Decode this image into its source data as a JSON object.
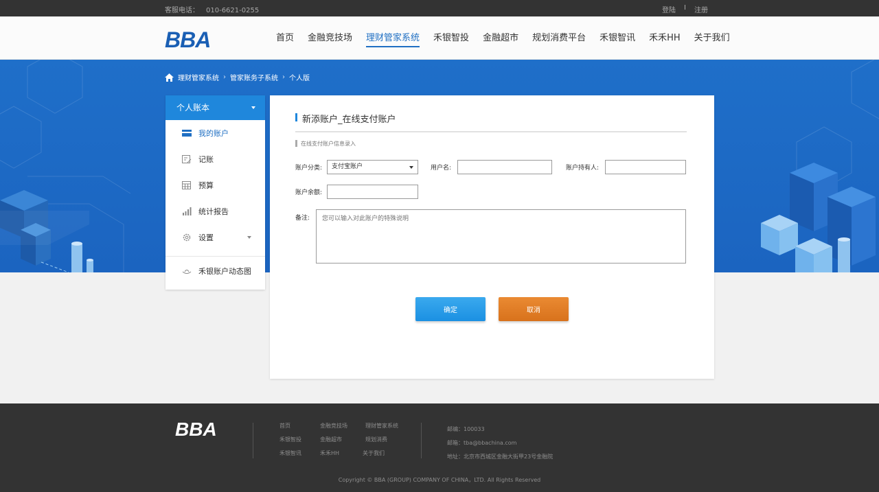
{
  "topbar": {
    "phone_label": "客服电话：",
    "phone_number": "010-6621-0255",
    "login": "登陆",
    "separator": "I",
    "register": "注册"
  },
  "header": {
    "logo": "BBA",
    "nav": [
      "首页",
      "金融竞技场",
      "理财管家系统",
      "禾银智投",
      "金融超市",
      "规划消费平台",
      "禾银智讯",
      "禾禾HH",
      "关于我们"
    ],
    "active_nav_index": 2
  },
  "breadcrumb": [
    "理财管家系统",
    "管家账务子系统",
    "个人版"
  ],
  "sidebar": {
    "head": "个人账本",
    "items": [
      "我的账户",
      "记账",
      "预算",
      "统计报告",
      "设置"
    ],
    "extra": "禾银账户动态图"
  },
  "form": {
    "title": "新添账户_在线支付账户",
    "subtitle": "在线支付账户信息录入",
    "account_type_label": "账户分类:",
    "account_type_value": "支付宝账户",
    "username_label": "用户名:",
    "holder_label": "账户持有人:",
    "balance_label": "账户余额:",
    "note_label": "备注:",
    "note_placeholder": "您可以输入对此账户的特殊说明",
    "ok": "确定",
    "cancel": "取消"
  },
  "footer": {
    "logo": "BBA",
    "links": [
      "首页",
      "金融竞技场",
      "理财管家系统",
      "禾银智投",
      "金融超市",
      "规划消费",
      "禾银智讯",
      "禾禾HH",
      "关于我们"
    ],
    "postcode": "邮编：100033",
    "email": "邮箱：tba@bbachina.com",
    "address": "地址：北京市西城区金融大街甲23号金融院",
    "copyright": "Copyright © BBA (GROUP) COMPANY OF CHINA，LTD. All Rights Reserved"
  },
  "colors": {
    "brand_blue": "#1f6fc3",
    "sidebar_head": "#1f87dc",
    "ok_button": "#1b90e2",
    "cancel_button": "#d8721c",
    "banner": "#1f6fc9"
  }
}
